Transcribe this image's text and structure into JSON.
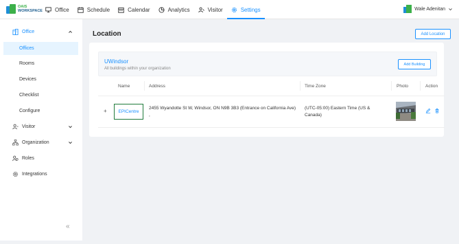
{
  "header": {
    "logo_line1": "OAIS",
    "logo_line2": "WORKSPACE",
    "nav": [
      {
        "label": "Office",
        "icon": "monitor-icon",
        "active": false
      },
      {
        "label": "Schedule",
        "icon": "calendar-icon",
        "active": false
      },
      {
        "label": "Calendar",
        "icon": "calendar-grid-icon",
        "active": false
      },
      {
        "label": "Analytics",
        "icon": "pie-chart-icon",
        "active": false
      },
      {
        "label": "Visitor",
        "icon": "visitor-icon",
        "active": false
      },
      {
        "label": "Settings",
        "icon": "gear-icon",
        "active": true
      }
    ],
    "user_name": "Wale Adenitan"
  },
  "sidebar": {
    "office": {
      "label": "Office",
      "icon": "building-icon"
    },
    "office_children": [
      "Offices",
      "Rooms",
      "Devices",
      "Checklist",
      "Configure"
    ],
    "active_child": "Offices",
    "visitor": {
      "label": "Visitor",
      "icon": "user-icon"
    },
    "organization": {
      "label": "Organization",
      "icon": "org-icon"
    },
    "roles": {
      "label": "Roles",
      "icon": "roles-icon"
    },
    "integrations": {
      "label": "Integrations",
      "icon": "gear-icon"
    },
    "collapse_glyph": "«"
  },
  "main": {
    "title": "Location",
    "add_location_label": "Add Location",
    "organization": {
      "name": "UWindsor",
      "subtitle": "All buildings within your organization",
      "add_building_label": "Add Building"
    },
    "table": {
      "columns": [
        "Name",
        "Address",
        "Time Zone",
        "Photo",
        "Action"
      ],
      "rows": [
        {
          "expand": "+",
          "name": "EPICentre",
          "address": "2455 Wyandotte St W, Windsor, ON N9B 3B3 (Entrance on California Ave) ,",
          "timezone": "(UTC-05:00) Eastern Time (US & Canada)"
        }
      ]
    }
  },
  "colors": {
    "accent": "#1890ff",
    "brand_green": "#3cb04a",
    "brand_blue": "#1f8fd6",
    "selected_bg": "#e6f4ff"
  }
}
